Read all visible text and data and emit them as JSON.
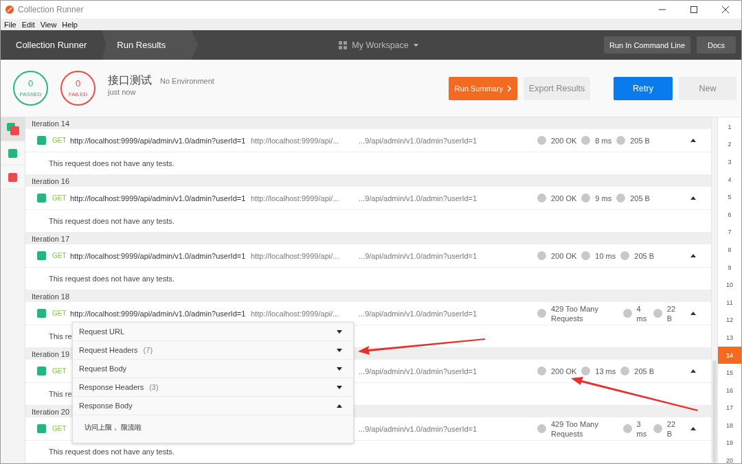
{
  "window": {
    "title": "Collection Runner"
  },
  "menu": [
    "File",
    "Edit",
    "View",
    "Help"
  ],
  "breadcrumbs": [
    {
      "label": "Collection Runner",
      "selected": false
    },
    {
      "label": "Run Results",
      "selected": true
    }
  ],
  "workspace": "My Workspace",
  "nav_buttons": [
    "Run In Command Line",
    "Docs"
  ],
  "summary": {
    "passed": {
      "count": "0",
      "label": "PASSED"
    },
    "failed": {
      "count": "0",
      "label": "FAILED"
    },
    "title": "接口测试",
    "environment": "No Environment",
    "time": "just now"
  },
  "actions": [
    {
      "label": "Run Summary",
      "kind": "summary"
    },
    {
      "label": "Export Results",
      "kind": "secondary"
    },
    {
      "label": "Retry",
      "kind": "primary"
    },
    {
      "label": "New",
      "kind": "secondary"
    }
  ],
  "filters": [
    {
      "kind": "all",
      "selected": true
    },
    {
      "kind": "passed",
      "selected": false
    },
    {
      "kind": "failed",
      "selected": false
    }
  ],
  "iterations": [
    {
      "title": "Iteration 14",
      "request": {
        "method": "GET",
        "url": "http://localhost:9999/api/admin/v1.0/admin?userId=1",
        "url_2": "http://localhost:9999/api/...",
        "url_3": "...9/api/admin/v1.0/admin?userId=1",
        "status": "200 OK",
        "time": "8 ms",
        "size": "205 B"
      },
      "tests": "This request does not have any tests."
    },
    {
      "title": "Iteration 16",
      "request": {
        "method": "GET",
        "url": "http://localhost:9999/api/admin/v1.0/admin?userId=1",
        "url_2": "http://localhost:9999/api/...",
        "url_3": "...9/api/admin/v1.0/admin?userId=1",
        "status": "200 OK",
        "time": "9 ms",
        "size": "205 B"
      },
      "tests": "This request does not have any tests."
    },
    {
      "title": "Iteration 17",
      "request": {
        "method": "GET",
        "url": "http://localhost:9999/api/admin/v1.0/admin?userId=1",
        "url_2": "http://localhost:9999/api/...",
        "url_3": "...9/api/admin/v1.0/admin?userId=1",
        "status": "200 OK",
        "time": "10 ms",
        "size": "205 B"
      },
      "tests": "This request does not have any tests."
    },
    {
      "title": "Iteration 18",
      "request": {
        "method": "GET",
        "url": "http://localhost:9999/api/admin/v1.0/admin?userId=1",
        "url_2": "http://localhost:9999/api/...",
        "url_3": "...9/api/admin/v1.0/admin?userId=1",
        "status": "429 Too Many Requests",
        "time": "4 ms",
        "size": "22 B"
      },
      "tests": "This re"
    },
    {
      "title": "Iteration 19",
      "request": {
        "method": "GET",
        "url_3": "...9/api/admin/v1.0/admin?userId=1",
        "status": "200 OK",
        "time": "13 ms",
        "size": "205 B"
      },
      "tests": "This re"
    },
    {
      "title": "Iteration 20",
      "request": {
        "method": "GET",
        "url_3": "...9/api/admin/v1.0/admin?userId=1",
        "status": "429 Too Many Requests",
        "time": "3 ms",
        "size": "22 B"
      },
      "tests": "This request does not have any tests."
    }
  ],
  "iteration_index": [
    {
      "label": "1",
      "selected": false
    },
    {
      "label": "2",
      "selected": false
    },
    {
      "label": "3",
      "selected": false
    },
    {
      "label": "4",
      "selected": false
    },
    {
      "label": "5",
      "selected": false
    },
    {
      "label": "6",
      "selected": false
    },
    {
      "label": "7",
      "selected": false
    },
    {
      "label": "8",
      "selected": false
    },
    {
      "label": "9",
      "selected": false
    },
    {
      "label": "10",
      "selected": false
    },
    {
      "label": "11",
      "selected": false
    },
    {
      "label": "12",
      "selected": false
    },
    {
      "label": "13",
      "selected": false
    },
    {
      "label": "14",
      "selected": true
    },
    {
      "label": "15",
      "selected": false
    },
    {
      "label": "16",
      "selected": false
    },
    {
      "label": "17",
      "selected": false
    },
    {
      "label": "18",
      "selected": false
    },
    {
      "label": "19",
      "selected": false
    },
    {
      "label": "20",
      "selected": false
    }
  ],
  "details_popup": {
    "sections": [
      {
        "label": "Request URL",
        "expanded": false
      },
      {
        "label": "Request Headers",
        "count": "(7)",
        "expanded": false
      },
      {
        "label": "Request Body",
        "expanded": false
      },
      {
        "label": "Response Headers",
        "count": "(3)",
        "expanded": false
      },
      {
        "label": "Response Body",
        "expanded": true,
        "body": "访问上限， 限流啦"
      }
    ]
  }
}
